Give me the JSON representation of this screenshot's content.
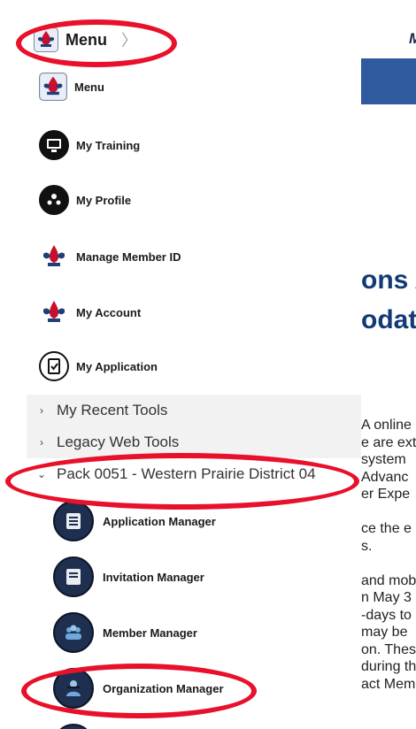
{
  "header": {
    "menu_label": "Menu",
    "chevron": "〉",
    "partial_right": "M"
  },
  "menu_items": [
    {
      "label": "Menu",
      "icon": "bsa-fleur-icon"
    },
    {
      "label": "My Training",
      "icon": "training-icon"
    },
    {
      "label": "My Profile",
      "icon": "profile-icon"
    },
    {
      "label": "Manage Member ID",
      "icon": "bsa-fleur-icon"
    },
    {
      "label": "My Account",
      "icon": "bsa-fleur-icon"
    },
    {
      "label": "My Application",
      "icon": "application-check-icon"
    }
  ],
  "sections": [
    {
      "label": "My Recent Tools",
      "caret": "›"
    },
    {
      "label": "Legacy Web Tools",
      "caret": "›"
    },
    {
      "label": "Pack 0051 - Western Prairie District 04",
      "caret": "⌄"
    }
  ],
  "sub_items": [
    {
      "label": "Application Manager",
      "icon": "application-manager-icon"
    },
    {
      "label": "Invitation Manager",
      "icon": "invitation-manager-icon"
    },
    {
      "label": "Member Manager",
      "icon": "member-manager-icon"
    },
    {
      "label": "Organization Manager",
      "icon": "organization-manager-icon"
    }
  ],
  "background": {
    "title_line1": "ons A",
    "title_line2": "odat",
    "text_lines": [
      "A online",
      "e are ext",
      "system",
      "Advanc",
      "er Expe",
      "",
      "ce the e",
      "s.",
      "",
      "and mob",
      "n May 3",
      "-days to",
      "may be",
      "on. Thes",
      "during th",
      "act Mem"
    ]
  },
  "colors": {
    "highlight_ring": "#e8102a",
    "brand_blue": "#2f5b9e",
    "title_blue": "#123a75"
  }
}
